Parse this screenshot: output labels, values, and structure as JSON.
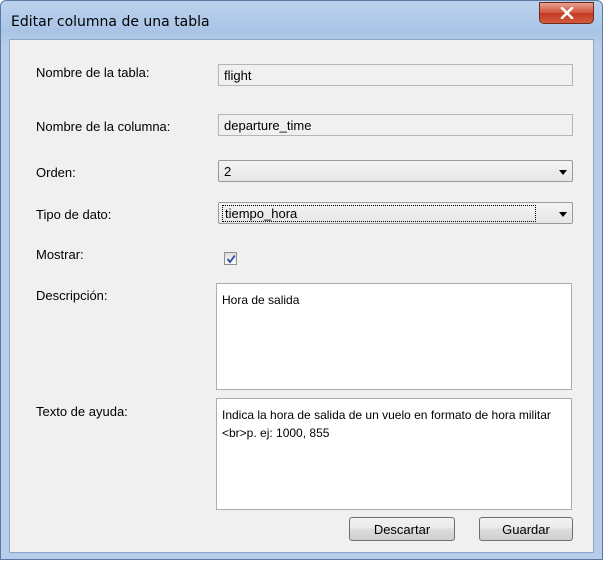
{
  "window": {
    "title": "Editar columna de una tabla"
  },
  "form": {
    "table_name_label": "Nombre de la tabla:",
    "table_name_value": "flight",
    "column_name_label": "Nombre de la columna:",
    "column_name_value": "departure_time",
    "order_label": "Orden:",
    "order_value": "2",
    "data_type_label": "Tipo de dato:",
    "data_type_value": "tiempo_hora",
    "show_label": "Mostrar:",
    "show_checked": true,
    "description_label": "Descripción:",
    "description_value": "Hora de salida",
    "help_text_label": "Texto de ayuda:",
    "help_text_value": "Indica la hora de salida de un vuelo en formato de hora militar <br>p. ej: 1000, 855"
  },
  "buttons": {
    "discard_label": "Descartar",
    "save_label": "Guardar"
  },
  "colors": {
    "titlebar": "#a9c4e6",
    "close_button": "#c9432b",
    "dialog_background": "#f0f0f0",
    "checkmark": "#2a4fa8"
  }
}
